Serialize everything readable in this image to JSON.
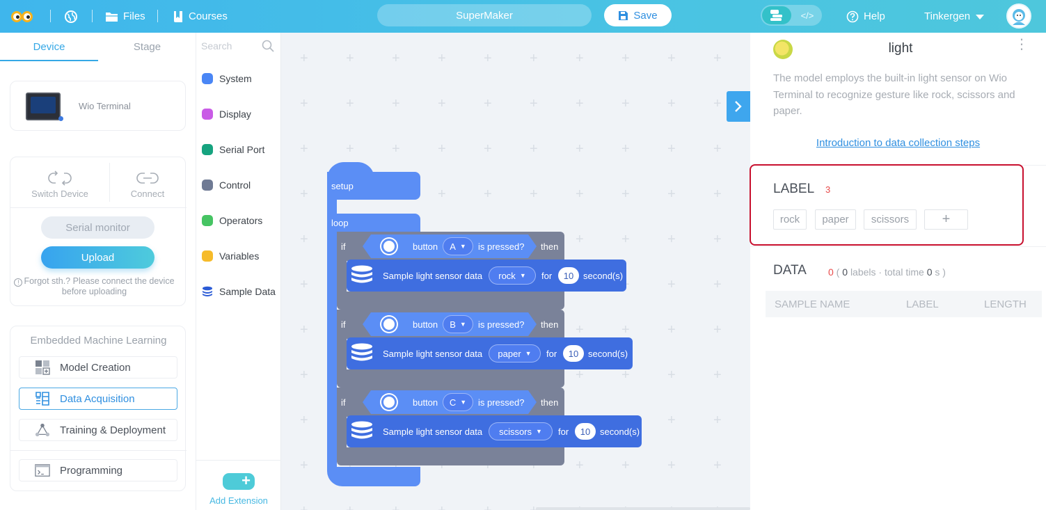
{
  "topbar": {
    "files": "Files",
    "courses": "Courses",
    "project_name": "SuperMaker",
    "save": "Save",
    "code_toggle": "</>",
    "help": "Help",
    "user": "Tinkergen"
  },
  "left": {
    "tabs": [
      "Device",
      "Stage"
    ],
    "device_name": "Wio Terminal",
    "switch_device": "Switch Device",
    "connect": "Connect",
    "serial_monitor": "Serial monitor",
    "upload": "Upload",
    "hint": "Forgot sth.? Please connect the device before uploading",
    "ml_title": "Embedded Machine Learning",
    "ml_items": [
      "Model Creation",
      "Data Acquisition",
      "Training & Deployment"
    ],
    "programming": "Programming"
  },
  "toolbox": {
    "search_placeholder": "Search",
    "categories": [
      {
        "label": "System",
        "color": "#4a86f5"
      },
      {
        "label": "Display",
        "color": "#c95be6"
      },
      {
        "label": "Serial Port",
        "color": "#16a37f"
      },
      {
        "label": "Control",
        "color": "#6f7a94"
      },
      {
        "label": "Operators",
        "color": "#46c463"
      },
      {
        "label": "Variables",
        "color": "#f6bb2a"
      },
      {
        "label": "Sample Data",
        "color": "#2b5bd6"
      }
    ],
    "add_extension": "Add Extension"
  },
  "blocks": {
    "setup": "setup",
    "loop": "loop",
    "if_label": "if",
    "then_label": "then",
    "button_label": "button",
    "is_pressed": "is pressed?",
    "sample_label": "Sample light sensor data",
    "for_label": "for",
    "seconds_label": "second(s)",
    "rows": [
      {
        "button": "A",
        "label": "rock",
        "seconds": "10"
      },
      {
        "button": "B",
        "label": "paper",
        "seconds": "10"
      },
      {
        "button": "C",
        "label": "scissors",
        "seconds": "10"
      }
    ]
  },
  "right": {
    "model_title": "light",
    "description": "The model employs the built-in light sensor on Wio Terminal to recognize gesture like rock, scissors and paper.",
    "intro_link": "Introduction to data collection steps",
    "label_title": "LABEL",
    "label_count": "3",
    "labels": [
      "rock",
      "paper",
      "scissors"
    ],
    "add_label": "+",
    "data_title": "DATA",
    "data_count": "0",
    "data_labels_count": "0",
    "data_labels_text": "labels",
    "data_total_text": "total time",
    "data_total_time": "0",
    "data_unit": "s",
    "table_headers": [
      "SAMPLE NAME",
      "LABEL",
      "LENGTH"
    ]
  },
  "colors": {
    "accent": "#35a8e6",
    "highlight_box": "#c8102e",
    "block_blue": "#5b8ef5",
    "block_dark": "#3f6ee0",
    "block_control": "#7a8299"
  }
}
